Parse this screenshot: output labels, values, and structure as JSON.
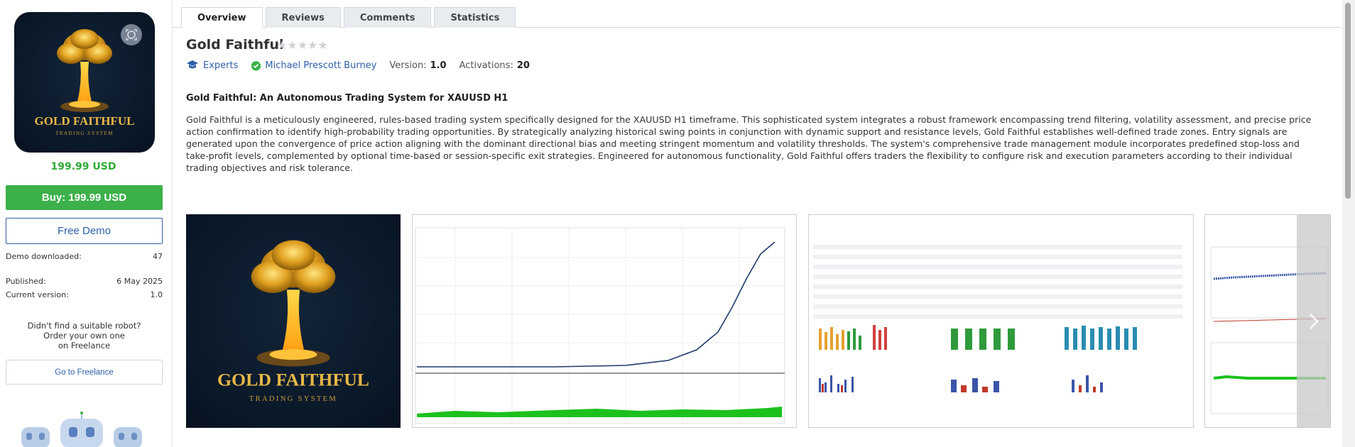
{
  "product": {
    "price_display": "199.99 USD",
    "buy_label": "Buy: 199.99 USD",
    "demo_label": "Free Demo",
    "stats": [
      {
        "label": "Demo downloaded:",
        "value": "47"
      },
      {
        "label": "Published:",
        "value": "6 May 2025"
      },
      {
        "label": "Current version:",
        "value": "1.0"
      }
    ],
    "freelance_text": [
      "Didn't find a suitable robot?",
      "Order your own one",
      "on Freelance"
    ],
    "freelance_button": "Go to Freelance",
    "logo_title": "GOLD FAITHFUL",
    "logo_subtitle": "TRADING SYSTEM"
  },
  "tabs": [
    "Overview",
    "Reviews",
    "Comments",
    "Statistics"
  ],
  "active_tab": "Overview",
  "header": {
    "title": "Gold Faithful",
    "rating_stars": 0,
    "category": "Experts",
    "author": "Michael Prescott Burney",
    "version_label": "Version:",
    "version_value": "1.0",
    "activations_label": "Activations:",
    "activations_value": "20"
  },
  "description": {
    "subtitle": "Gold Faithful: An Autonomous Trading System for XAUUSD H1",
    "body": "Gold Faithful is a meticulously engineered, rules-based trading system specifically designed for the XAUUSD H1 timeframe. This sophisticated system integrates a robust framework encompassing trend filtering, volatility assessment, and precise price action confirmation to identify high-probability trading opportunities. By strategically analyzing historical swing points in conjunction with dynamic support and resistance levels, Gold Faithful establishes well-defined trade zones. Entry signals are generated upon the convergence of price action aligning with the dominant directional bias and meeting stringent momentum and volatility thresholds. The system's comprehensive trade management module incorporates predefined stop-loss and take-profit levels, complemented by optional time-based or session-specific exit strategies. Engineered for autonomous functionality, Gold Faithful offers traders the flexibility to configure risk and execution parameters according to their individual trading objectives and risk tolerance."
  },
  "gallery": {
    "items": [
      "logo",
      "balance-chart",
      "report-tables",
      "distribution-chart"
    ],
    "accent_green": "#3cb04a",
    "accent_blue": "#2f5fa7"
  }
}
